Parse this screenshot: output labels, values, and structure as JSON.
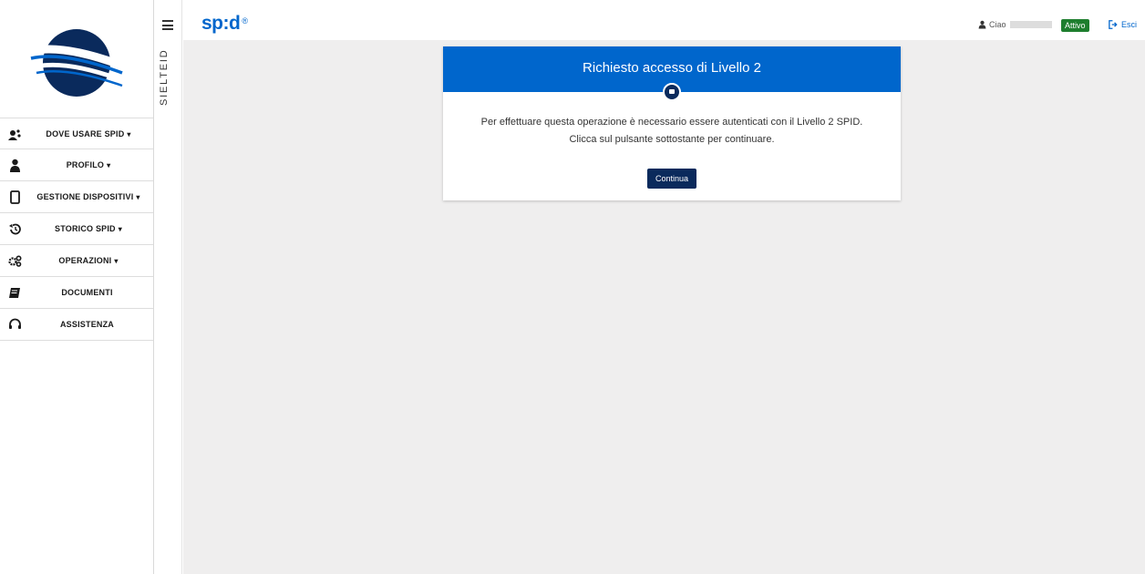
{
  "brand": {
    "vertical": "SIELTEID",
    "spid": "sp:d",
    "spid_mark": "®"
  },
  "sidebar": {
    "items": [
      {
        "label": "DOVE USARE SPID",
        "caret": "▾",
        "icon": "users-icon"
      },
      {
        "label": "PROFILO",
        "caret": "▾",
        "icon": "user-icon"
      },
      {
        "label": "GESTIONE DISPOSITIVI",
        "caret": "▾",
        "icon": "mobile-icon"
      },
      {
        "label": "STORICO SPID",
        "caret": "▾",
        "icon": "history-icon"
      },
      {
        "label": "OPERAZIONI",
        "caret": "▾",
        "icon": "gears-icon"
      },
      {
        "label": "DOCUMENTI",
        "caret": "",
        "icon": "book-icon"
      },
      {
        "label": "ASSISTENZA",
        "caret": "",
        "icon": "headset-icon"
      }
    ]
  },
  "header": {
    "greeting": "Ciao",
    "status": "Attivo",
    "logout": "Esci"
  },
  "card": {
    "title": "Richiesto accesso di Livello 2",
    "line1": "Per effettuare questa operazione è necessario essere autenticati con il Livello 2 SPID.",
    "line2": "Clicca sul pulsante sottostante per continuare.",
    "button": "Continua"
  },
  "colors": {
    "primary": "#0066cc",
    "dark": "#0a2a5c",
    "status": "#1e7e2e",
    "background": "#efeeee"
  }
}
